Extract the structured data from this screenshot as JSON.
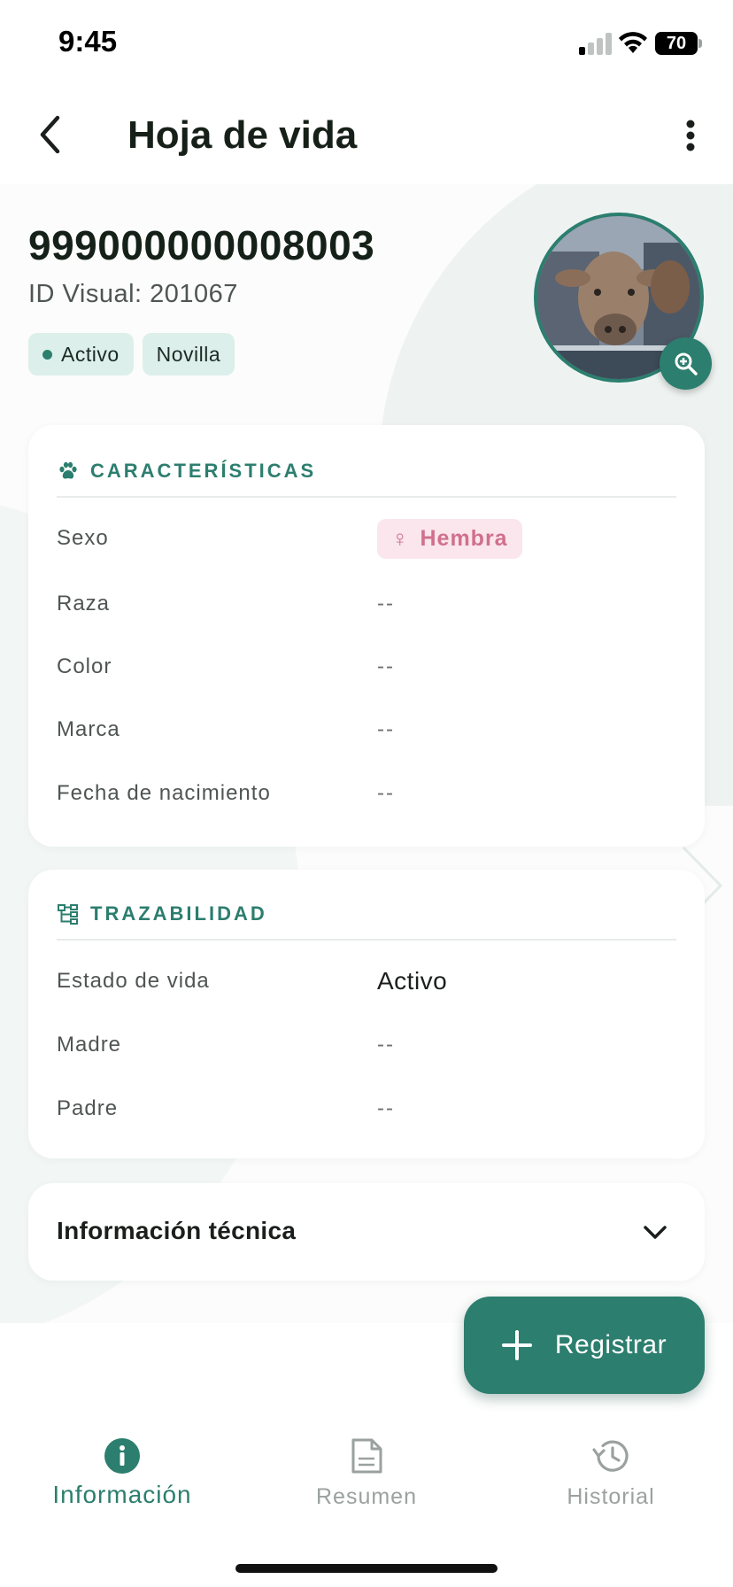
{
  "status_bar": {
    "time": "9:45",
    "battery": "70"
  },
  "header": {
    "title": "Hoja de vida"
  },
  "animal": {
    "id": "999000000008003",
    "visual_id_text": "ID Visual: 201067",
    "tags": [
      {
        "label": "Activo",
        "dot": true
      },
      {
        "label": "Novilla",
        "dot": false
      }
    ]
  },
  "caracteristicas": {
    "title": "CARACTERÍSTICAS",
    "icon": "paw-icon",
    "rows": [
      {
        "label": "Sexo",
        "value": "Hembra",
        "type": "badge"
      },
      {
        "label": "Raza",
        "value": "--"
      },
      {
        "label": "Color",
        "value": "--"
      },
      {
        "label": "Marca",
        "value": "--"
      },
      {
        "label": "Fecha de nacimiento",
        "value": "--"
      }
    ]
  },
  "trazabilidad": {
    "title": "TRAZABILIDAD",
    "icon": "tree-structure-icon",
    "rows": [
      {
        "label": "Estado de vida",
        "value": "Activo"
      },
      {
        "label": "Madre",
        "value": "--"
      },
      {
        "label": "Padre",
        "value": "--"
      }
    ]
  },
  "informacion_tecnica": {
    "title": "Información técnica"
  },
  "fab": {
    "label": "Registrar"
  },
  "bottom_nav": {
    "items": [
      {
        "label": "Información",
        "icon": "info-icon",
        "active": true
      },
      {
        "label": "Resumen",
        "icon": "document-icon",
        "active": false
      },
      {
        "label": "Historial",
        "icon": "history-icon",
        "active": false
      }
    ]
  },
  "colors": {
    "accent": "#2c7e6e",
    "tag_bg": "#dcefea",
    "female_badge_bg": "#fae6ec",
    "female_badge_text": "#d0708e"
  }
}
